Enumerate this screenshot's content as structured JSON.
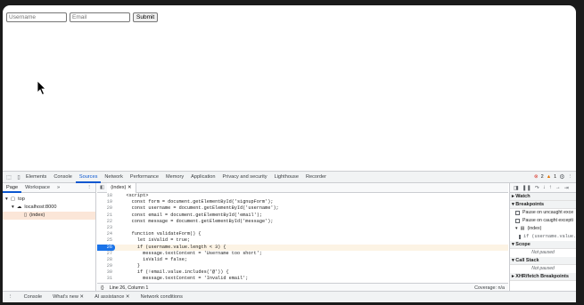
{
  "page": {
    "username_placeholder": "Username",
    "email_placeholder": "Email",
    "submit_label": "Submit"
  },
  "devtools": {
    "tabs": [
      "Elements",
      "Console",
      "Sources",
      "Network",
      "Performance",
      "Memory",
      "Application",
      "Privacy and security",
      "Lighthouse",
      "Recorder"
    ],
    "active_tab": "Sources",
    "errors": "2",
    "warnings": "1",
    "left_tabs": [
      "Page",
      "Workspace"
    ],
    "tree": [
      "top",
      "localhost:8000",
      "(index)"
    ],
    "file_tab": "(index)",
    "code_lines": [
      {
        "n": "18",
        "t": "    <script>"
      },
      {
        "n": "19",
        "t": "      const form = document.getElementById('signupForm');"
      },
      {
        "n": "20",
        "t": "      const username = document.getElementById('username');"
      },
      {
        "n": "21",
        "t": "      const email = document.getElementById('email');"
      },
      {
        "n": "22",
        "t": "      const message = document.getElementById('message');"
      },
      {
        "n": "23",
        "t": ""
      },
      {
        "n": "24",
        "t": "      function validateForm() {"
      },
      {
        "n": "25",
        "t": "        let isValid = true;"
      },
      {
        "n": "26",
        "t": "        if (username.value.length < 3) {"
      },
      {
        "n": "27",
        "t": "          message.textContent = 'Username too short';"
      },
      {
        "n": "28",
        "t": "          isValid = false;"
      },
      {
        "n": "29",
        "t": "        }"
      },
      {
        "n": "30",
        "t": "        if (!email.value.includes('@')) {"
      },
      {
        "n": "31",
        "t": "          message.textContent = 'Invalid email';"
      }
    ],
    "breakpoint_line": "26",
    "status_position": "Line 26, Column 1",
    "coverage": "Coverage: n/a",
    "right": {
      "watch": "Watch",
      "breakpoints": "Breakpoints",
      "pause_uncaught": "Pause on uncaught exce",
      "pause_caught": "Pause on caught excepti",
      "bp_file": "(index)",
      "bp_code": "if (username.value.le",
      "scope": "Scope",
      "not_paused": "Not paused",
      "call_stack": "Call Stack",
      "xhr": "XHR/fetch Breakpoints"
    },
    "drawer_tabs": [
      "Console",
      "What's new ✕",
      "AI assistance ✕",
      "Network conditions"
    ]
  }
}
